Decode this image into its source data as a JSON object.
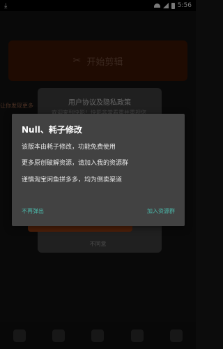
{
  "statusbar": {
    "time": "5:56"
  },
  "background": {
    "start_button_label": "开始剪辑",
    "side_text": "让你发现更多"
  },
  "privacy_dialog": {
    "title": "用户协议及隐私政策",
    "body": "欢迎来到快影！快影非常看重并重视您的隐私安全和个人信息保护，请充分阅读",
    "decline_label": "不同意"
  },
  "dialog": {
    "title": "Null、耗子修改",
    "line1": "该版本由耗子修改，功能免费使用",
    "line2": "更多原创破解资源，请加入我的资源群",
    "line3": "谨慎淘宝闲鱼拼多多，均为倒卖渠道",
    "btn_no_more": "不再弹出",
    "btn_join": "加入资源群"
  }
}
